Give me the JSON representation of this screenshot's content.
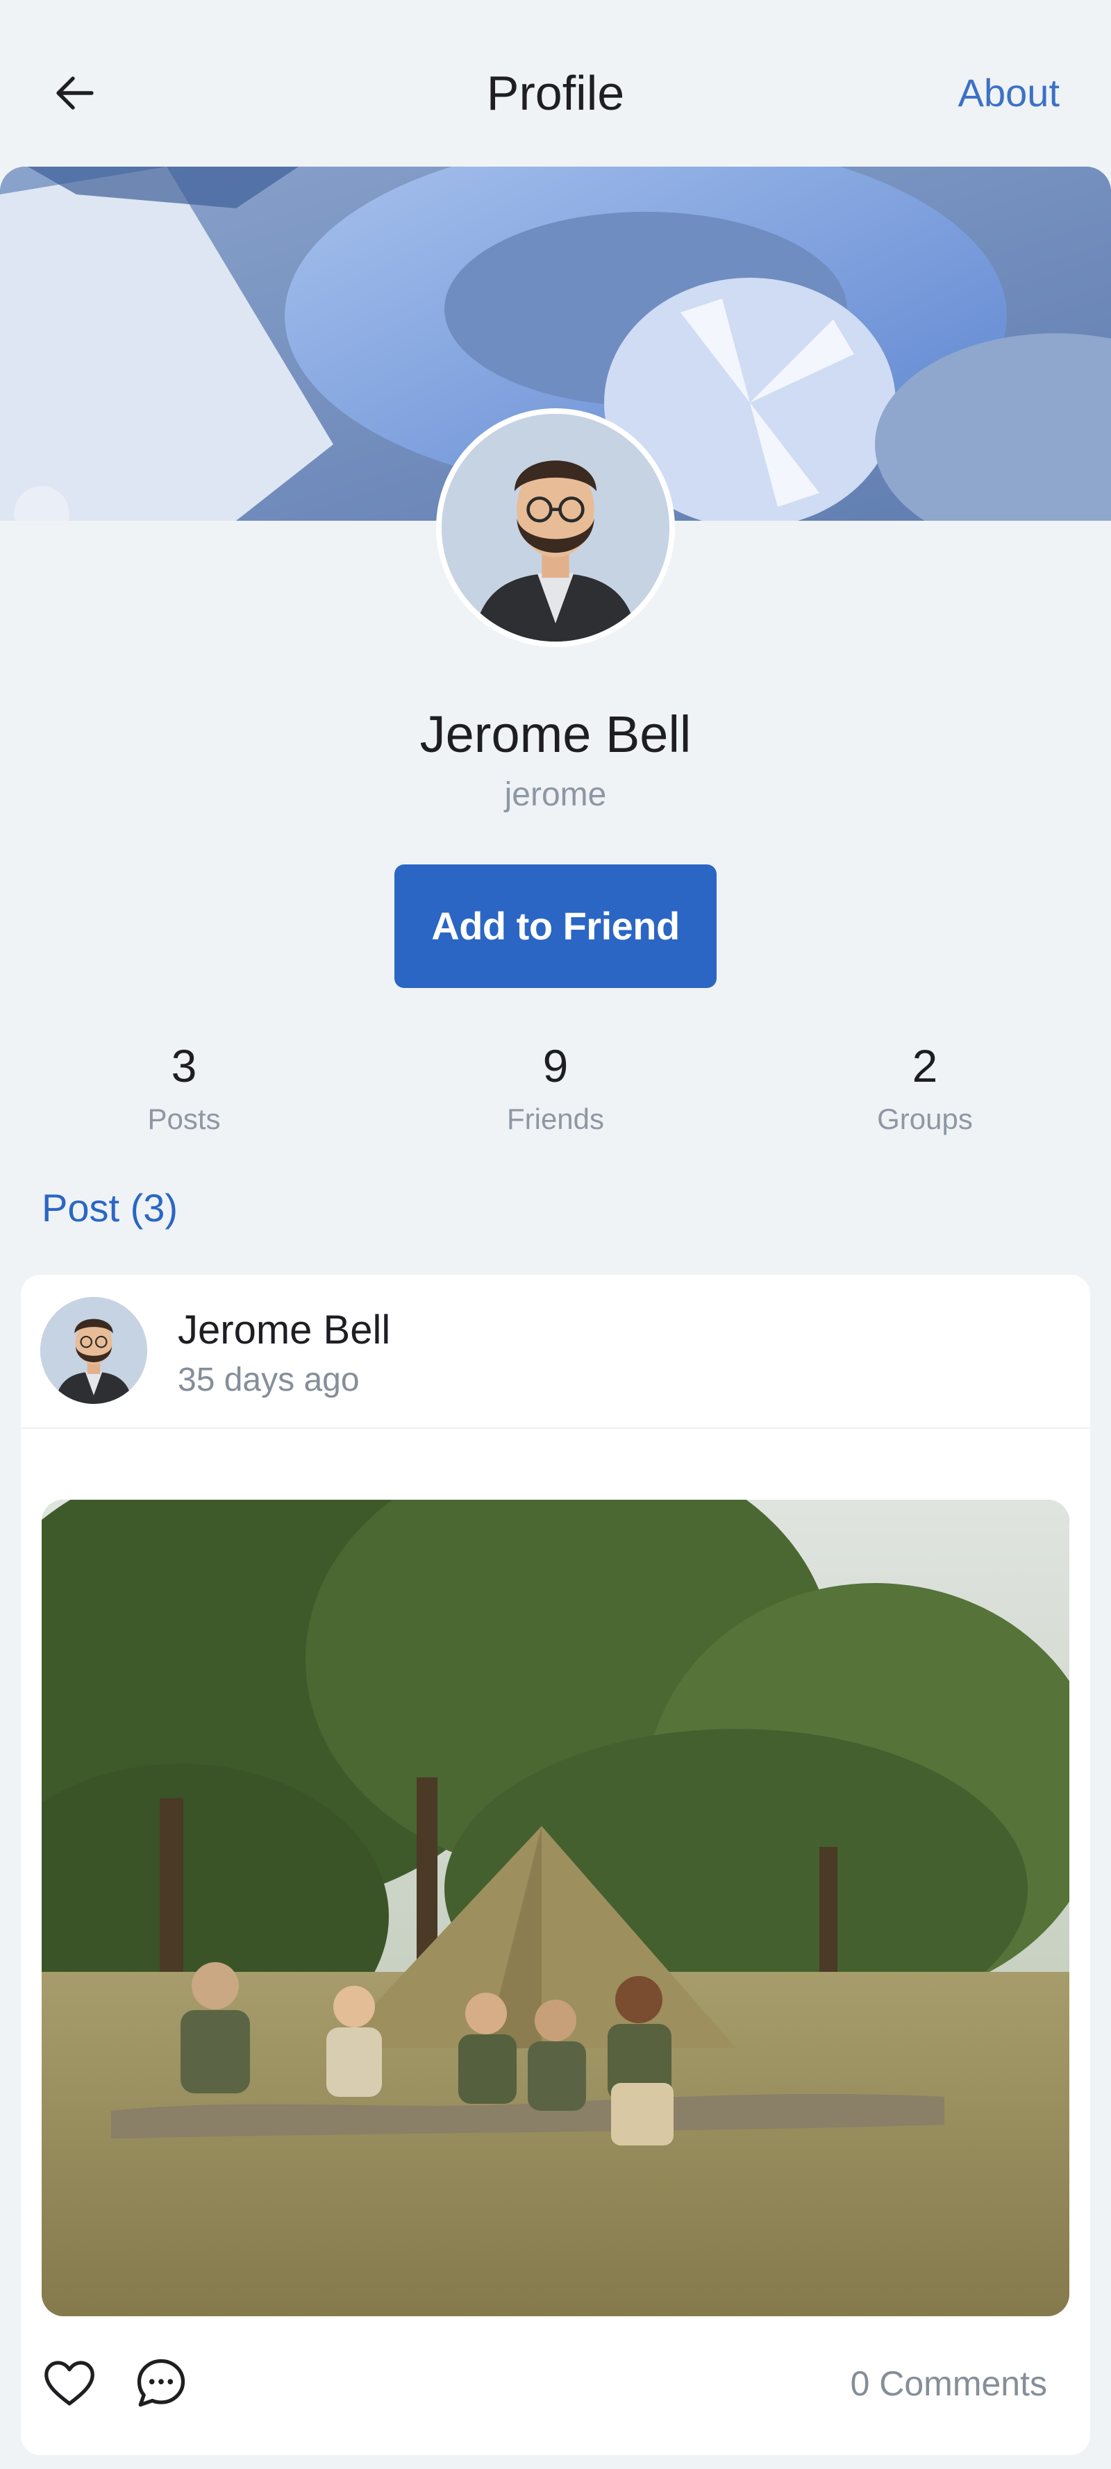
{
  "header": {
    "title": "Profile",
    "about_label": "About",
    "back_icon": "arrow-left-icon"
  },
  "profile": {
    "name": "Jerome Bell",
    "username": "jerome",
    "add_friend_label": "Add to Friend"
  },
  "stats": [
    {
      "value": "3",
      "label": "Posts"
    },
    {
      "value": "9",
      "label": "Friends"
    },
    {
      "value": "2",
      "label": "Groups"
    }
  ],
  "posts_heading": "Post (3)",
  "post": {
    "author": "Jerome Bell",
    "time": "35 days ago",
    "comments": "0 Comments",
    "like_icon": "heart-icon",
    "comment_icon": "chat-bubble-icon"
  },
  "colors": {
    "accent": "#2b66c4",
    "background": "#eff3f6",
    "muted_text": "#8e97a2"
  }
}
